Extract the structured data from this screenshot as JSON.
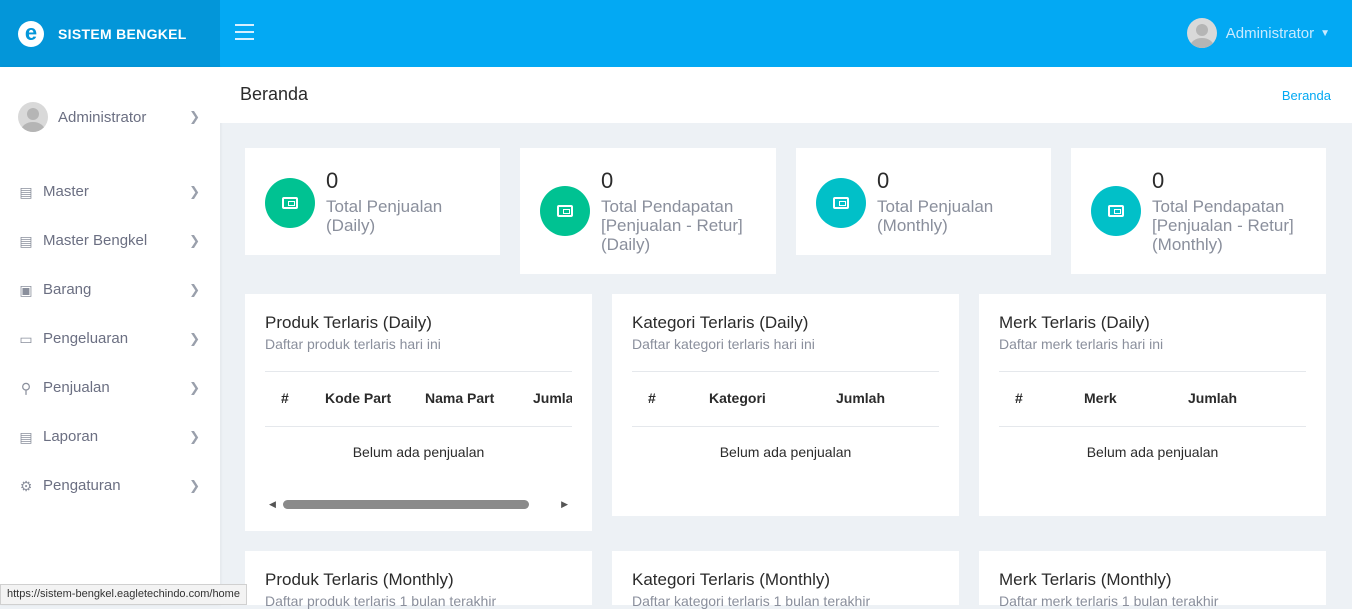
{
  "topbar": {
    "brand": "SISTEM BENGKEL",
    "brand_logo": "e",
    "user": "Administrator"
  },
  "sidebar": {
    "user": "Administrator",
    "items": [
      {
        "label": "Master",
        "icon": "list-icon"
      },
      {
        "label": "Master Bengkel",
        "icon": "storage-icon"
      },
      {
        "label": "Barang",
        "icon": "box-icon"
      },
      {
        "label": "Pengeluaran",
        "icon": "credit-card-icon"
      },
      {
        "label": "Penjualan",
        "icon": "cart-icon"
      },
      {
        "label": "Laporan",
        "icon": "report-icon"
      },
      {
        "label": "Pengaturan",
        "icon": "gear-icon"
      }
    ]
  },
  "status_url": "https://sistem-bengkel.eagletechindo.com/home",
  "page": {
    "title": "Beranda",
    "breadcrumb": "Beranda"
  },
  "stats": [
    {
      "value": "0",
      "label": "Total Penjualan (Daily)",
      "color": "#00c292"
    },
    {
      "value": "0",
      "label": "Total Pendapatan [Penjualan - Retur] (Daily)",
      "color": "#00c292"
    },
    {
      "value": "0",
      "label": "Total Penjualan (Monthly)",
      "color": "#01c0c8"
    },
    {
      "value": "0",
      "label": "Total Pendapatan [Penjualan - Retur] (Monthly)",
      "color": "#01c0c8"
    }
  ],
  "tables": [
    {
      "title": "Produk Terlaris (Daily)",
      "subtitle": "Daftar produk terlaris hari ini",
      "columns": [
        "#",
        "Kode Part",
        "Nama Part",
        "Jumlah"
      ],
      "empty": "Belum ada penjualan"
    },
    {
      "title": "Kategori Terlaris (Daily)",
      "subtitle": "Daftar kategori terlaris hari ini",
      "columns": [
        "#",
        "Kategori",
        "Jumlah"
      ],
      "empty": "Belum ada penjualan"
    },
    {
      "title": "Merk Terlaris (Daily)",
      "subtitle": "Daftar merk terlaris hari ini",
      "columns": [
        "#",
        "Merk",
        "Jumlah"
      ],
      "empty": "Belum ada penjualan"
    },
    {
      "title": "Produk Terlaris (Monthly)",
      "subtitle": "Daftar produk terlaris 1 bulan terakhir"
    },
    {
      "title": "Kategori Terlaris (Monthly)",
      "subtitle": "Daftar kategori terlaris 1 bulan terakhir"
    },
    {
      "title": "Merk Terlaris (Monthly)",
      "subtitle": "Daftar merk terlaris 1 bulan terakhir"
    }
  ]
}
